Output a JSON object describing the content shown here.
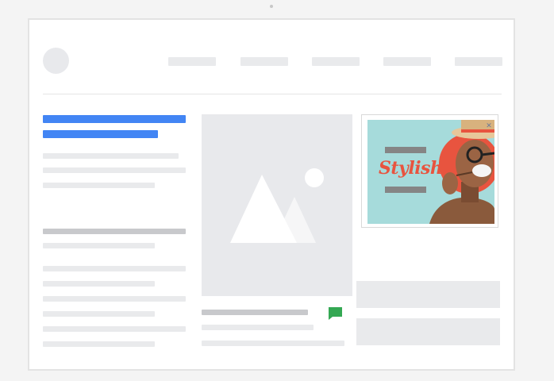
{
  "ad": {
    "headline": "Stylish",
    "close_glyph": "✕",
    "background_color": "#a6dbdb",
    "headline_color": "#e8543f",
    "accent_circle_color": "#e8543f"
  },
  "icons": {
    "logo": "logo-placeholder-circle",
    "media": "image-placeholder-icon",
    "comment": "chat-bubble-icon"
  },
  "colors": {
    "highlight": "#4285f4",
    "placeholder": "#e9eaec",
    "placeholder_dark": "#c8c9cc",
    "chat_icon": "#34a853",
    "page_background": "#f4f4f4"
  }
}
